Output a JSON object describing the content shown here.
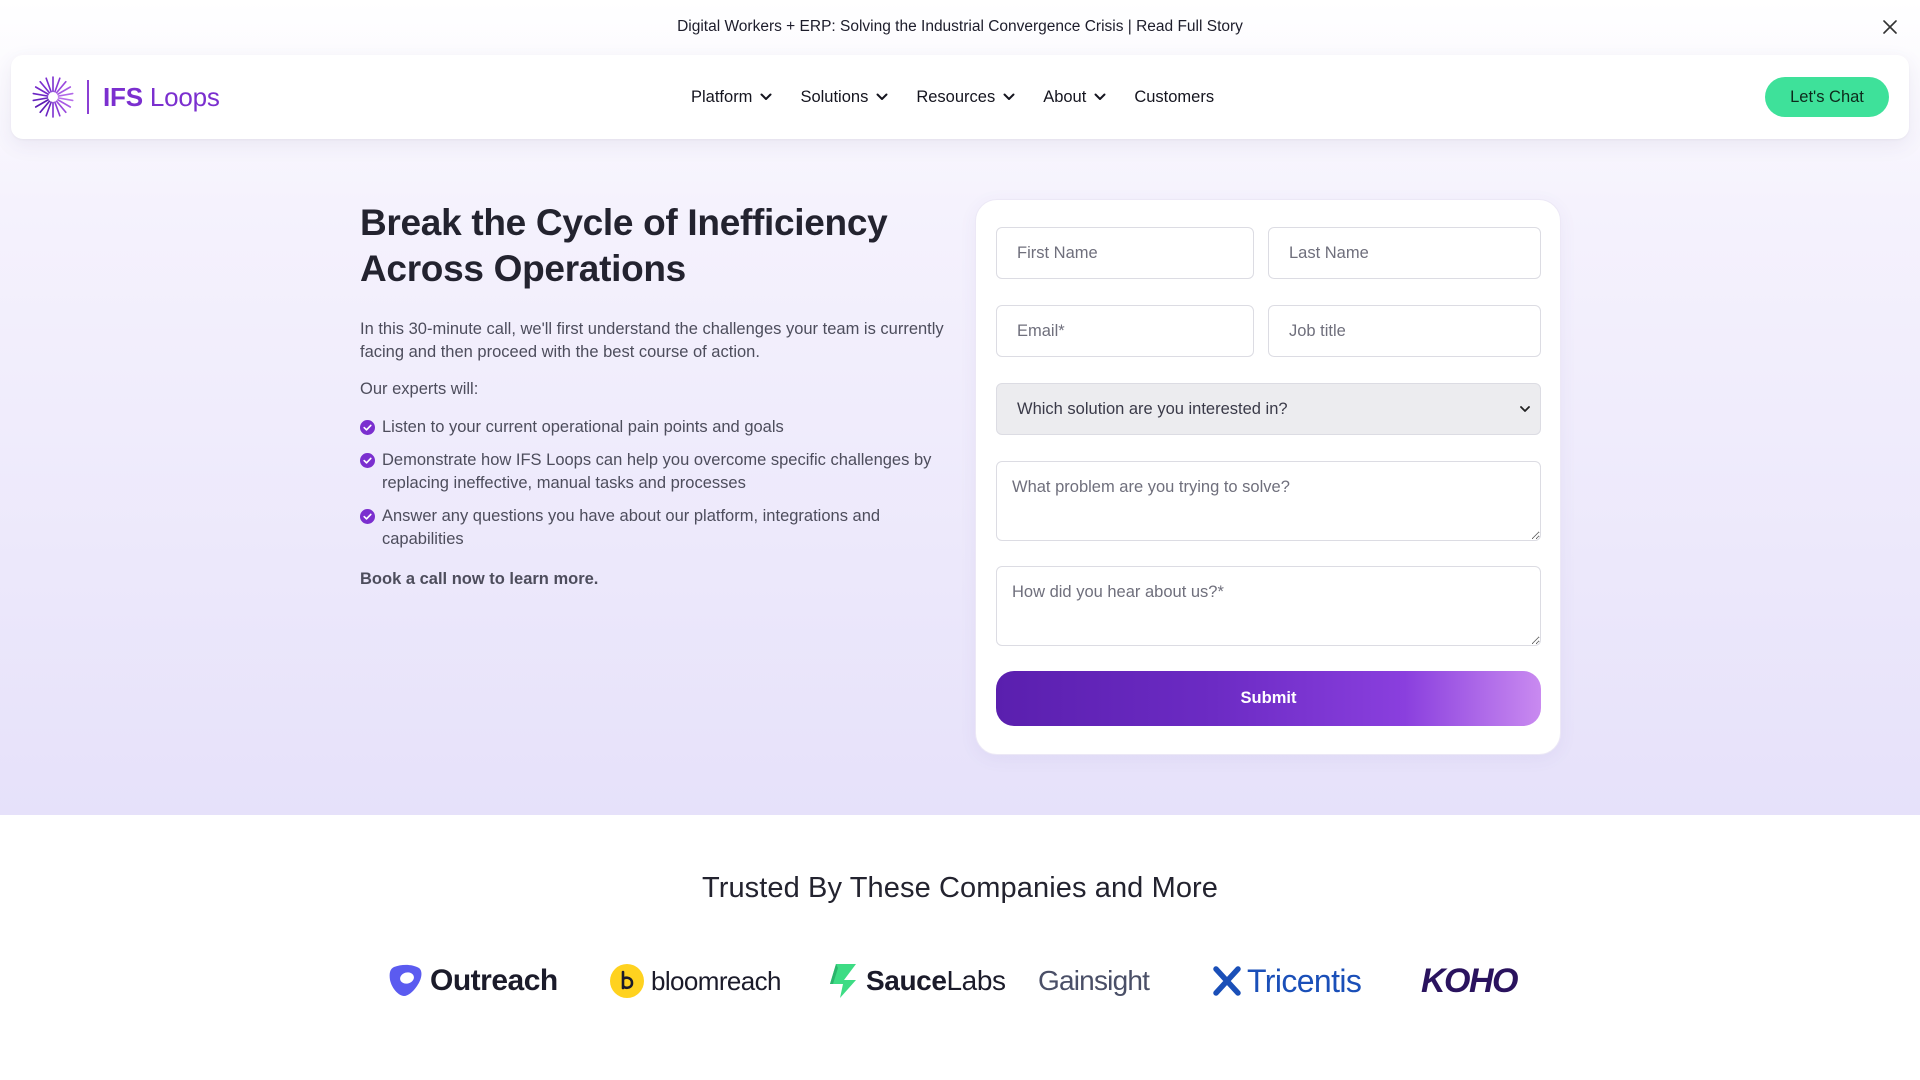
{
  "announcement": {
    "text": "Digital Workers + ERP: Solving the Industrial Convergence Crisis | Read Full Story",
    "close_icon": "close-icon"
  },
  "nav": {
    "logo_text_bold": "IFS",
    "logo_text_regular": "Loops",
    "menu": [
      {
        "label": "Platform",
        "has_dropdown": true
      },
      {
        "label": "Solutions",
        "has_dropdown": true
      },
      {
        "label": "Resources",
        "has_dropdown": true
      },
      {
        "label": "About",
        "has_dropdown": true
      },
      {
        "label": "Customers",
        "has_dropdown": false
      }
    ],
    "cta_label": "Let's Chat"
  },
  "hero": {
    "headline": "Break the Cycle of Inefficiency Across Operations",
    "intro": "In this 30-minute call, we'll first understand the challenges your team is currently facing and then proceed with the best course of action.",
    "experts_label": "Our experts will:",
    "bullets": [
      "Listen to your current operational pain points and goals",
      "Demonstrate how IFS Loops can help you overcome specific challenges by replacing ineffective, manual tasks and processes",
      "Answer any questions you have about our platform, integrations and capabilities"
    ],
    "book_text": "Book a call now to learn more."
  },
  "form": {
    "first_name_placeholder": "First Name",
    "last_name_placeholder": "Last Name",
    "email_placeholder": "Email*",
    "job_title_placeholder": "Job title",
    "solution_select": "Which solution are you interested in?",
    "problem_placeholder": "What problem are you trying to solve?",
    "hear_placeholder": "How did you hear about us?*",
    "submit_label": "Submit"
  },
  "trusted": {
    "title": "Trusted By These Companies and More",
    "logos": [
      {
        "name": "Outreach",
        "icon": "outreach-logo"
      },
      {
        "name": "bloomreach",
        "icon": "bloomreach-logo"
      },
      {
        "name": "Sauce",
        "name_suffix": "Labs",
        "icon": "saucelabs-logo"
      },
      {
        "name": "Gainsight",
        "icon": "gainsight-logo"
      },
      {
        "name": "Tricentis",
        "icon": "tricentis-logo"
      },
      {
        "name": "KOHO",
        "icon": "koho-logo"
      }
    ]
  },
  "colors": {
    "brand_purple": "#7b2fcf",
    "cta_green": "#3ee19a",
    "submit_gradient_start": "#5a1fae",
    "submit_gradient_end": "#c98af0",
    "hero_background": "#ece8fb"
  }
}
